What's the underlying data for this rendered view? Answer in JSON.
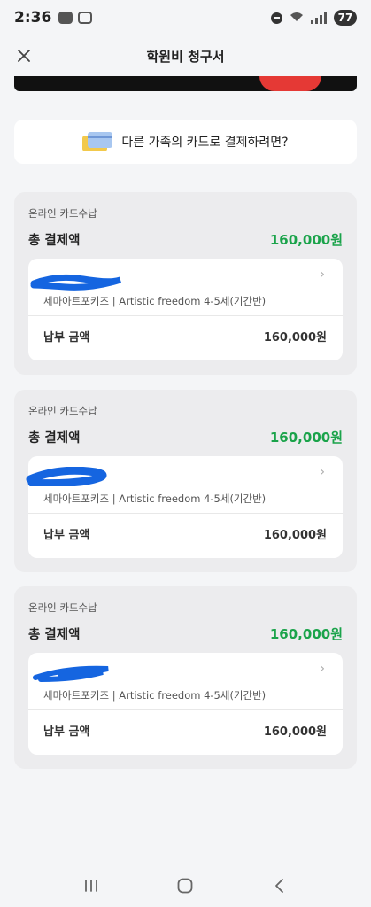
{
  "status_bar": {
    "time": "2:36",
    "battery": "77"
  },
  "header": {
    "title": "학원비 청구서"
  },
  "other_card": {
    "label": "다른 가족의 카드로 결제하려면?"
  },
  "groups": [
    {
      "method": "온라인 카드수납",
      "total_label": "총 결제액",
      "total_amount": "160,000원",
      "item": {
        "description": "세마아트포키즈 | Artistic freedom 4-5세(기간반)",
        "pay_label": "납부 금액",
        "pay_amount": "160,000원"
      }
    },
    {
      "method": "온라인 카드수납",
      "total_label": "총 결제액",
      "total_amount": "160,000원",
      "item": {
        "description": "세마아트포키즈 | Artistic freedom 4-5세(기간반)",
        "pay_label": "납부 금액",
        "pay_amount": "160,000원"
      }
    },
    {
      "method": "온라인 카드수납",
      "total_label": "총 결제액",
      "total_amount": "160,000원",
      "item": {
        "description": "세마아트포키즈 | Artistic freedom 4-5세(기간반)",
        "pay_label": "납부 금액",
        "pay_amount": "160,000원"
      }
    }
  ],
  "icons": {
    "close": "close-icon",
    "card": "credit-card-icon",
    "chevron": "chevron-right-icon",
    "redaction": "redaction-scribble",
    "nav_recent": "recent-apps-icon",
    "nav_home": "home-icon",
    "nav_back": "back-icon"
  },
  "colors": {
    "accent_green": "#1aa34a",
    "redaction_blue": "#1565e0",
    "background": "#f4f5f7"
  }
}
